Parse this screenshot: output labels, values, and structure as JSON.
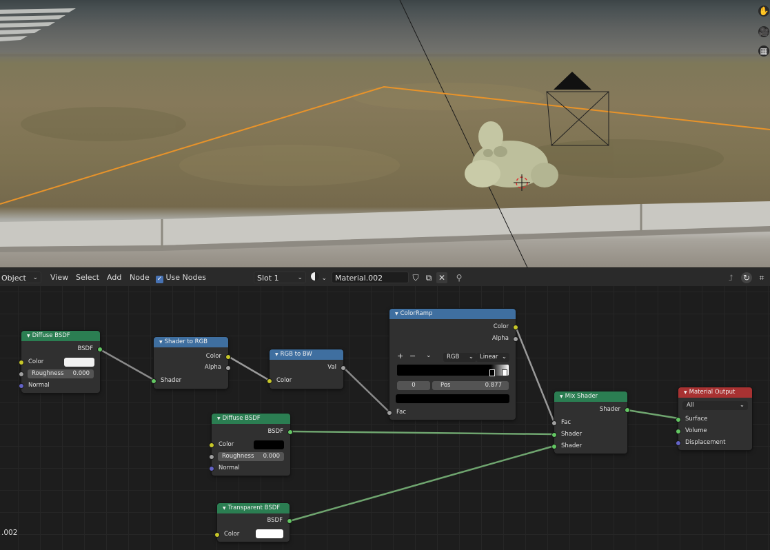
{
  "header": {
    "mode_label": "Object",
    "menus": [
      "View",
      "Select",
      "Add",
      "Node"
    ],
    "use_nodes_label": "Use Nodes",
    "use_nodes_checked": true,
    "slot_label": "Slot 1",
    "material_name": "Material.002"
  },
  "viewport": {
    "right_icons": [
      "hand-icon",
      "camera-icon",
      "grid-icon"
    ]
  },
  "bottom_left_text": ".002",
  "nodes": {
    "diffuse1": {
      "title": "Diffuse BSDF",
      "output": "BSDF",
      "color_label": "Color",
      "color": "#f2f2f2",
      "roughness_label": "Roughness",
      "roughness_value": "0.000",
      "normal_label": "Normal"
    },
    "shader_to_rgb": {
      "title": "Shader to RGB",
      "out_color": "Color",
      "out_alpha": "Alpha",
      "in_shader": "Shader"
    },
    "rgb_to_bw": {
      "title": "RGB to BW",
      "out_val": "Val",
      "in_color": "Color"
    },
    "colorramp": {
      "title": "ColorRamp",
      "out_color": "Color",
      "out_alpha": "Alpha",
      "add": "+",
      "remove": "−",
      "color_mode": "RGB",
      "interpolation": "Linear",
      "stop_index": "0",
      "pos_label": "Pos",
      "pos_value": "0.877",
      "in_fac": "Fac"
    },
    "diffuse2": {
      "title": "Diffuse BSDF",
      "output": "BSDF",
      "color_label": "Color",
      "color": "#000000",
      "roughness_label": "Roughness",
      "roughness_value": "0.000",
      "normal_label": "Normal"
    },
    "transparent": {
      "title": "Transparent BSDF",
      "output": "BSDF",
      "color_label": "Color",
      "color": "#ffffff"
    },
    "mix_shader": {
      "title": "Mix Shader",
      "output": "Shader",
      "in_fac": "Fac",
      "in_shader1": "Shader",
      "in_shader2": "Shader"
    },
    "material_output": {
      "title": "Material Output",
      "target": "All",
      "in_surface": "Surface",
      "in_volume": "Volume",
      "in_displacement": "Displacement"
    }
  },
  "colors": {
    "shader_header": "#2b7e52",
    "converter_header": "#3f6fa0",
    "output_header": "#a83232",
    "selection_outline": "#e8932a"
  }
}
